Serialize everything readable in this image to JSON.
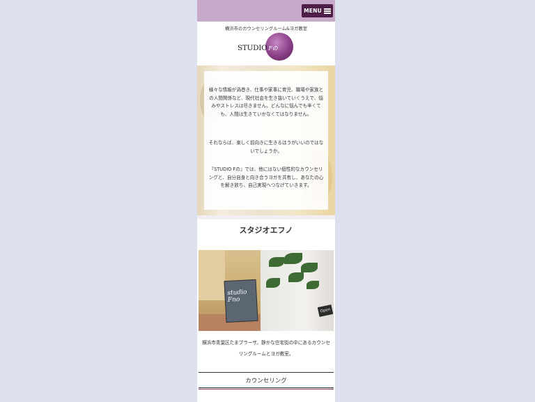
{
  "header": {
    "menu_label": "MENU",
    "tagline": "横浜市のカウンセリングルーム&ヨガ教室",
    "logo_text": "STUDIO",
    "logo_sub": "Fの"
  },
  "hero": {
    "paragraphs": [
      "様々な情報が渦巻き、仕事や家事に育児、職場や家族との人間関係など、現代社会を生き抜いていくうえで、悩みやストレスは尽きません。どんなに悩んでも辛くても、人間は生きていかなくてはなりません。",
      "それならば、楽しく前向きに生きるほうがいいのではないでしょうか。",
      "『STUDIO Fの』では、他にはない個性的なカウンセリングと、自分自身と向き合うヨガを共有し、あなたの心を解き放ち、自己実現へつなげていきます。"
    ]
  },
  "about": {
    "title": "スタジオエフノ",
    "photo_sign": "studio Fno",
    "photo_open": "Open",
    "caption": "横浜市青葉区たまプラーザ。静かな住宅街の中にあるカウンセリングルームとヨガ教室。"
  },
  "nav": {
    "counseling_label": "カウンセリング"
  },
  "colors": {
    "topbar": "#c7aac9",
    "menu_button": "#4e1e49",
    "background": "#dde0ee",
    "accent_line": "#8b2f5e"
  }
}
